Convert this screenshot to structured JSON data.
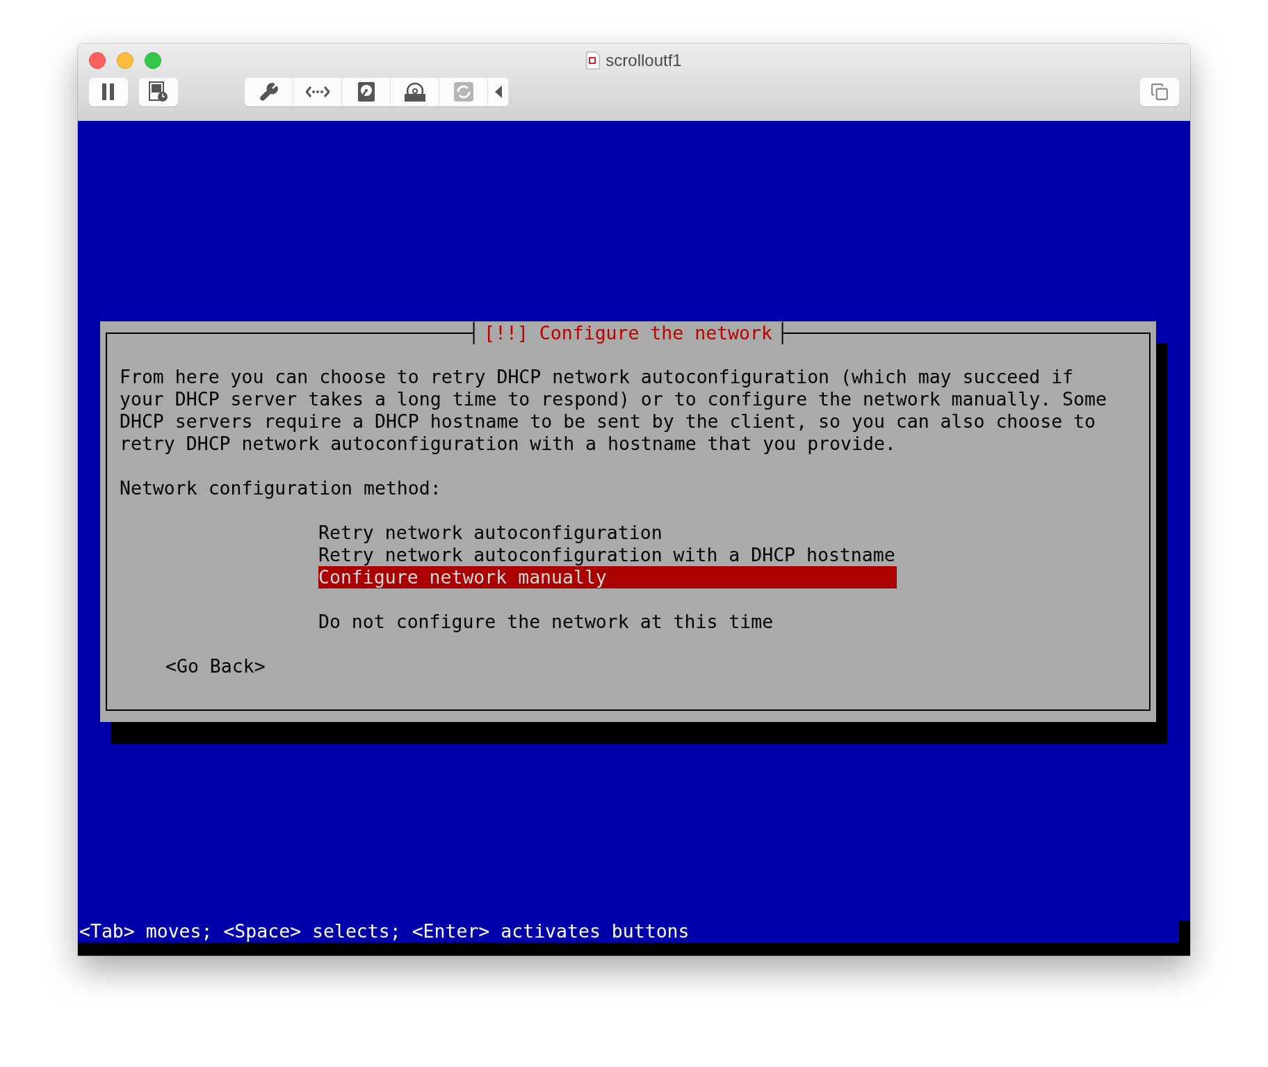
{
  "window": {
    "title": "scrolloutf1"
  },
  "dialog": {
    "title": "[!!] Configure the network",
    "description": "From here you can choose to retry DHCP network autoconfiguration (which may succeed if\nyour DHCP server takes a long time to respond) or to configure the network manually. Some\nDHCP servers require a DHCP hostname to be sent by the client, so you can also choose to\nretry DHCP network autoconfiguration with a hostname that you provide.",
    "prompt": "Network configuration method:",
    "option_groups": [
      [
        {
          "label": "Retry network autoconfiguration",
          "selected": false
        },
        {
          "label": "Retry network autoconfiguration with a DHCP hostname",
          "selected": false
        },
        {
          "label": "Configure network manually",
          "selected": true
        }
      ],
      [
        {
          "label": "Do not configure the network at this time",
          "selected": false
        }
      ]
    ],
    "back_button": "<Go Back>"
  },
  "status_bar": "<Tab> moves; <Space> selects; <Enter> activates buttons"
}
